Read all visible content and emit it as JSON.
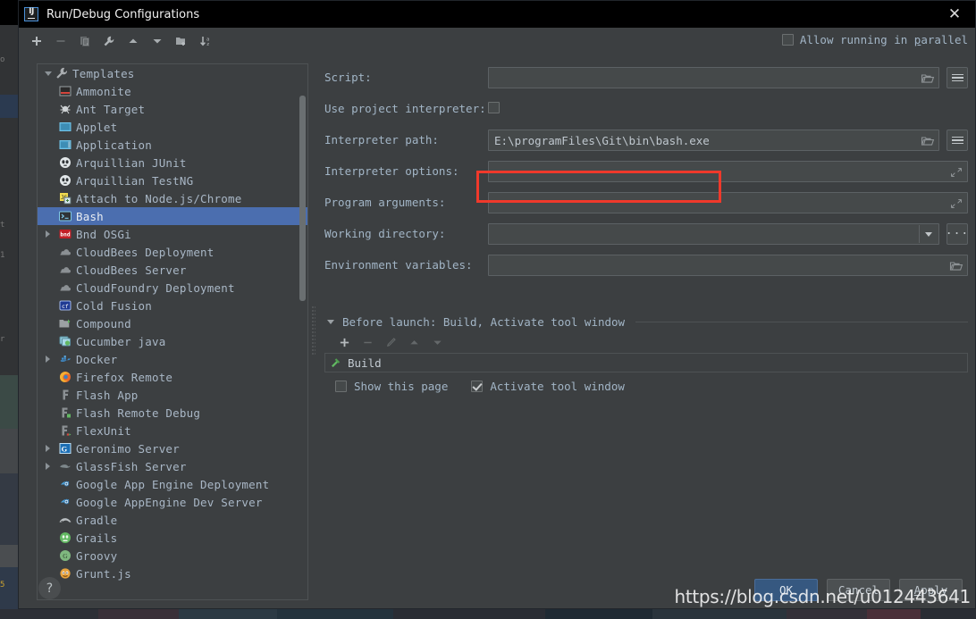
{
  "window": {
    "title": "Run/Debug Configurations",
    "logo_icon": "intellij-idea-icon",
    "close_icon": "close-icon"
  },
  "toolbar": {
    "buttons": [
      {
        "name": "add-configuration-button",
        "icon": "plus-icon",
        "enabled": true
      },
      {
        "name": "remove-configuration-button",
        "icon": "minus-icon",
        "enabled": false
      },
      {
        "name": "copy-configuration-button",
        "icon": "copy-icon",
        "enabled": false
      },
      {
        "name": "edit-templates-button",
        "icon": "wrench-icon",
        "enabled": true
      },
      {
        "name": "move-up-button",
        "icon": "arrow-up-icon",
        "enabled": true
      },
      {
        "name": "move-down-button",
        "icon": "arrow-down-icon",
        "enabled": true
      },
      {
        "name": "create-folder-button",
        "icon": "new-folder-icon",
        "enabled": true
      },
      {
        "name": "sort-configurations-button",
        "icon": "sort-az-icon",
        "enabled": true
      }
    ]
  },
  "allow_parallel": {
    "label_before": "Allow running in ",
    "label_underlined": "p",
    "label_after": "arallel",
    "full_label": "Allow running in parallel",
    "checked": false
  },
  "tree": {
    "root": {
      "label": "Templates",
      "icon": "wrench-icon",
      "expanded": true
    },
    "items": [
      {
        "label": "Ammonite",
        "icon": "ammonite-icon",
        "expandable": false,
        "selected": false
      },
      {
        "label": "Ant Target",
        "icon": "ant-icon",
        "expandable": false,
        "selected": false
      },
      {
        "label": "Applet",
        "icon": "applet-icon",
        "expandable": false,
        "selected": false
      },
      {
        "label": "Application",
        "icon": "application-icon",
        "expandable": false,
        "selected": false
      },
      {
        "label": "Arquillian JUnit",
        "icon": "arquillian-icon",
        "expandable": false,
        "selected": false
      },
      {
        "label": "Arquillian TestNG",
        "icon": "arquillian-icon",
        "expandable": false,
        "selected": false
      },
      {
        "label": "Attach to Node.js/Chrome",
        "icon": "nodejs-attach-icon",
        "expandable": false,
        "selected": false
      },
      {
        "label": "Bash",
        "icon": "bash-terminal-icon",
        "expandable": false,
        "selected": true
      },
      {
        "label": "Bnd OSGi",
        "icon": "bnd-icon",
        "expandable": true,
        "selected": false
      },
      {
        "label": "CloudBees Deployment",
        "icon": "cloud-icon",
        "expandable": false,
        "selected": false
      },
      {
        "label": "CloudBees Server",
        "icon": "cloud-icon",
        "expandable": false,
        "selected": false
      },
      {
        "label": "CloudFoundry Deployment",
        "icon": "cloud-icon",
        "expandable": false,
        "selected": false
      },
      {
        "label": "Cold Fusion",
        "icon": "coldfusion-icon",
        "expandable": false,
        "selected": false
      },
      {
        "label": "Compound",
        "icon": "folder-icon",
        "expandable": false,
        "selected": false
      },
      {
        "label": "Cucumber java",
        "icon": "cucumber-icon",
        "expandable": false,
        "selected": false
      },
      {
        "label": "Docker",
        "icon": "docker-icon",
        "expandable": true,
        "selected": false
      },
      {
        "label": "Firefox Remote",
        "icon": "firefox-icon",
        "expandable": false,
        "selected": false
      },
      {
        "label": "Flash App",
        "icon": "flash-icon",
        "expandable": false,
        "selected": false
      },
      {
        "label": "Flash Remote Debug",
        "icon": "flash-remote-icon",
        "expandable": false,
        "selected": false
      },
      {
        "label": "FlexUnit",
        "icon": "flexunit-icon",
        "expandable": false,
        "selected": false
      },
      {
        "label": "Geronimo Server",
        "icon": "geronimo-icon",
        "expandable": true,
        "selected": false
      },
      {
        "label": "GlassFish Server",
        "icon": "glassfish-icon",
        "expandable": true,
        "selected": false
      },
      {
        "label": "Google App Engine Deployment",
        "icon": "google-appengine-icon",
        "expandable": false,
        "selected": false
      },
      {
        "label": "Google AppEngine Dev Server",
        "icon": "google-appengine-icon",
        "expandable": false,
        "selected": false
      },
      {
        "label": "Gradle",
        "icon": "gradle-icon",
        "expandable": false,
        "selected": false
      },
      {
        "label": "Grails",
        "icon": "grails-icon",
        "expandable": false,
        "selected": false
      },
      {
        "label": "Groovy",
        "icon": "groovy-icon",
        "expandable": false,
        "selected": false
      },
      {
        "label": "Grunt.js",
        "icon": "grunt-icon",
        "expandable": false,
        "selected": false
      }
    ]
  },
  "form": {
    "fields": [
      {
        "name": "script",
        "label": "Script:",
        "type": "text-with-browse-and-menu",
        "value": "",
        "browse_icon": "folder-browse-icon",
        "menu_icon": "macro-list-icon",
        "highlighted": false
      },
      {
        "name": "use-project-interpreter",
        "label": "Use project interpreter:",
        "type": "checkbox",
        "checked": false,
        "highlighted": false
      },
      {
        "name": "interpreter-path",
        "label": "Interpreter path:",
        "type": "text-with-browse-and-menu",
        "value": "E:\\programFiles\\Git\\bin\\bash.exe",
        "browse_icon": "folder-browse-icon",
        "menu_icon": "macro-list-icon",
        "highlighted": true
      },
      {
        "name": "interpreter-options",
        "label": "Interpreter options:",
        "type": "text-with-expand",
        "value": "",
        "expand_icon": "expand-editor-icon",
        "highlighted": false
      },
      {
        "name": "program-arguments",
        "label": "Program arguments:",
        "type": "text-with-expand",
        "value": "",
        "expand_icon": "expand-editor-icon",
        "highlighted": false
      },
      {
        "name": "working-directory",
        "label": "Working directory:",
        "type": "combo-with-dots",
        "value": "",
        "dropdown_icon": "chevron-down-icon",
        "dots_label": "...",
        "highlighted": false
      },
      {
        "name": "environment-variables",
        "label": "Environment variables:",
        "type": "text-with-browse",
        "value": "",
        "browse_icon": "folder-browse-icon",
        "highlighted": false
      }
    ]
  },
  "before_launch": {
    "header": "Before launch: Build, Activate tool window",
    "expanded": true,
    "toolbar": [
      {
        "name": "add-task-button",
        "icon": "plus-icon",
        "enabled": true
      },
      {
        "name": "remove-task-button",
        "icon": "minus-icon",
        "enabled": false
      },
      {
        "name": "edit-task-button",
        "icon": "pencil-icon",
        "enabled": false
      },
      {
        "name": "move-task-up-button",
        "icon": "arrow-up-icon",
        "enabled": false
      },
      {
        "name": "move-task-down-button",
        "icon": "arrow-down-icon",
        "enabled": false
      }
    ],
    "tasks": [
      {
        "label": "Build",
        "icon": "build-hammer-icon"
      }
    ],
    "options": [
      {
        "name": "show-this-page",
        "label": "Show this page",
        "checked": false
      },
      {
        "name": "activate-tool-window",
        "label": "Activate tool window",
        "checked": true
      }
    ]
  },
  "footer": {
    "help_label": "?",
    "help_icon": "help-icon",
    "buttons": [
      {
        "name": "ok-button",
        "label": "OK",
        "primary": true,
        "underline_index": -1
      },
      {
        "name": "cancel-button",
        "label": "Cancel",
        "primary": false,
        "underline_index": -1
      },
      {
        "name": "apply-button",
        "label": "Apply",
        "primary": false,
        "underline_index": 0
      }
    ]
  },
  "watermark": {
    "text": "https://blog.csdn.net/u012443641"
  },
  "colors": {
    "dialog_bg": "#3c3f41",
    "titlebar_bg": "#000000",
    "field_bg": "#45494a",
    "field_border": "#5c6164",
    "label_text": "#a2b5c6",
    "tree_text": "#a9b7c6",
    "selection": "#4b6eaf",
    "highlight_red": "#f0392b",
    "primary_button": "#365880"
  }
}
